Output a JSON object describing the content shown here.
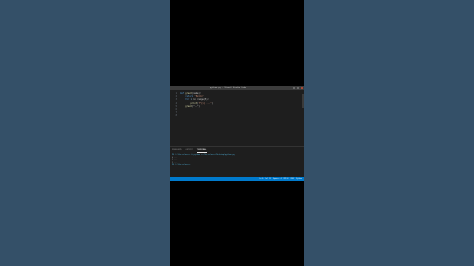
{
  "window": {
    "title": "python.py - Visual Studio Code"
  },
  "editor": {
    "lines": [
      {
        "n": "1",
        "parts": [
          {
            "c": "kw",
            "t": "def "
          },
          {
            "c": "fn",
            "t": "greet"
          },
          {
            "c": "code",
            "t": "(name):"
          }
        ]
      },
      {
        "n": "2",
        "parts": [
          {
            "c": "code",
            "t": "    "
          },
          {
            "c": "kw",
            "t": "return "
          },
          {
            "c": "str",
            "t": "\"Hello\""
          }
        ]
      },
      {
        "n": "3",
        "parts": [
          {
            "c": "code",
            "t": "    "
          },
          {
            "c": "kw",
            "t": "for "
          },
          {
            "c": "var",
            "t": "i"
          },
          {
            "c": "code",
            "t": " in range(5):"
          }
        ]
      },
      {
        "n": "4",
        "parts": [
          {
            "c": "code",
            "t": "        "
          },
          {
            "c": "fn",
            "t": "print"
          },
          {
            "c": "code",
            "t": "("
          },
          {
            "c": "str",
            "t": "f\"{i} ...\""
          },
          {
            "c": "code",
            "t": ")"
          }
        ]
      },
      {
        "n": "5",
        "parts": [
          {
            "c": "code",
            "t": "    "
          },
          {
            "c": "fn",
            "t": "greet"
          },
          {
            "c": "code",
            "t": "(\"..\")"
          }
        ]
      },
      {
        "n": "6",
        "parts": [
          {
            "c": "code",
            "t": ""
          }
        ]
      },
      {
        "n": "7",
        "parts": [
          {
            "c": "code",
            "t": ""
          }
        ]
      },
      {
        "n": "8",
        "parts": [
          {
            "c": "code",
            "t": ""
          }
        ]
      }
    ]
  },
  "panel": {
    "tabs": [
      {
        "label": "PROBLEMS",
        "active": false
      },
      {
        "label": "OUTPUT",
        "active": false
      },
      {
        "label": "TERMINAL",
        "active": true
      }
    ],
    "terminal_lines": [
      {
        "text": "PS C:\\Users\\user> & python c:/Users/user/Desktop/python.py",
        "kind": "path"
      },
      {
        "text": "0 ...",
        "kind": "plain"
      },
      {
        "text": "1 ...",
        "kind": "plain"
      },
      {
        "text": "2 ...",
        "kind": "plain"
      },
      {
        "text": "PS C:\\Users\\user>",
        "kind": "path"
      }
    ]
  },
  "statusbar": {
    "items": [
      "Ln 5, Col 12",
      "Spaces: 4",
      "UTF-8",
      "CRLF",
      "Python"
    ]
  },
  "colors": {
    "background": "#345068",
    "editor": "#1e1e1e",
    "statusbar": "#007acc"
  }
}
